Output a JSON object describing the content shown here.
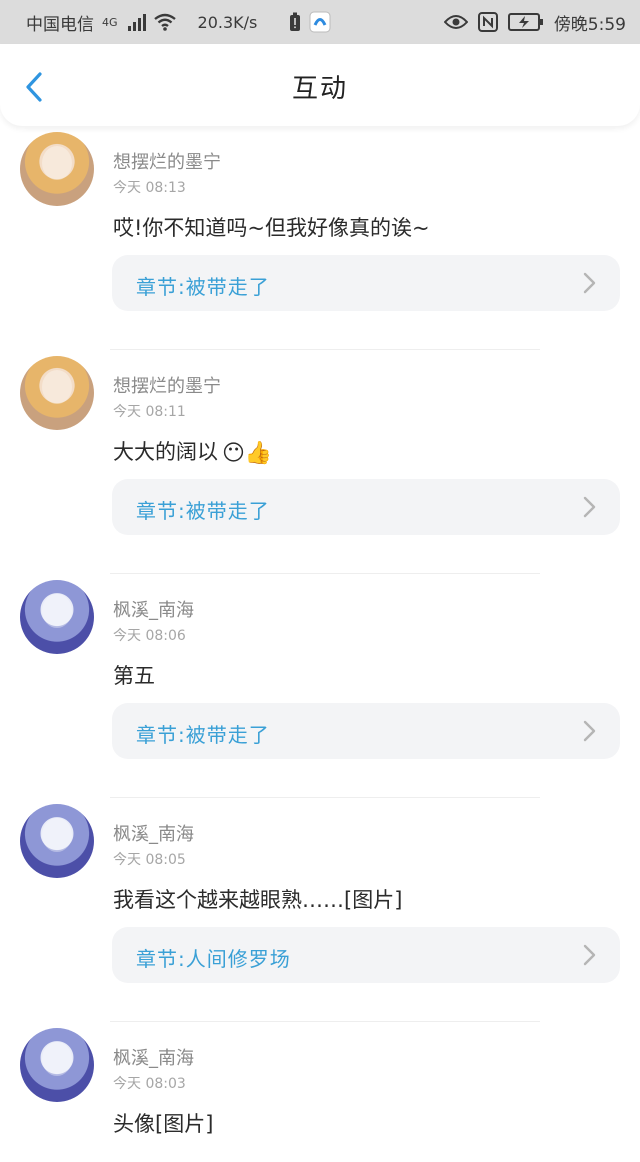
{
  "status_bar": {
    "carrier": "中国电信",
    "network": "4G",
    "speed": "20.3K/s",
    "time": "傍晚5:59"
  },
  "header": {
    "title": "互动",
    "back_icon": "back-arrow-icon"
  },
  "comments": [
    {
      "username": "想摆烂的墨宁",
      "time": "今天 08:13",
      "text": "哎!你不知道吗~但我好像真的诶~",
      "chapter": "章节:被带走了",
      "avatar": "a1"
    },
    {
      "username": "想摆烂的墨宁",
      "time": "今天 08:11",
      "text": "大大的阔以",
      "emojis": "😶👍",
      "chapter": "章节:被带走了",
      "avatar": "a1"
    },
    {
      "username": "枫溪_南海",
      "time": "今天 08:06",
      "text": "第五",
      "chapter": "章节:被带走了",
      "avatar": "a2"
    },
    {
      "username": "枫溪_南海",
      "time": "今天 08:05",
      "text": "我看这个越来越眼熟……[图片]",
      "chapter": "章节:人间修罗场",
      "avatar": "a2"
    },
    {
      "username": "枫溪_南海",
      "time": "今天 08:03",
      "text": "头像[图片]",
      "avatar": "a2"
    }
  ],
  "colors": {
    "accent": "#3aa0d6",
    "status_bar_bg": "#dcdcdc",
    "card_bg": "#f3f4f6"
  }
}
